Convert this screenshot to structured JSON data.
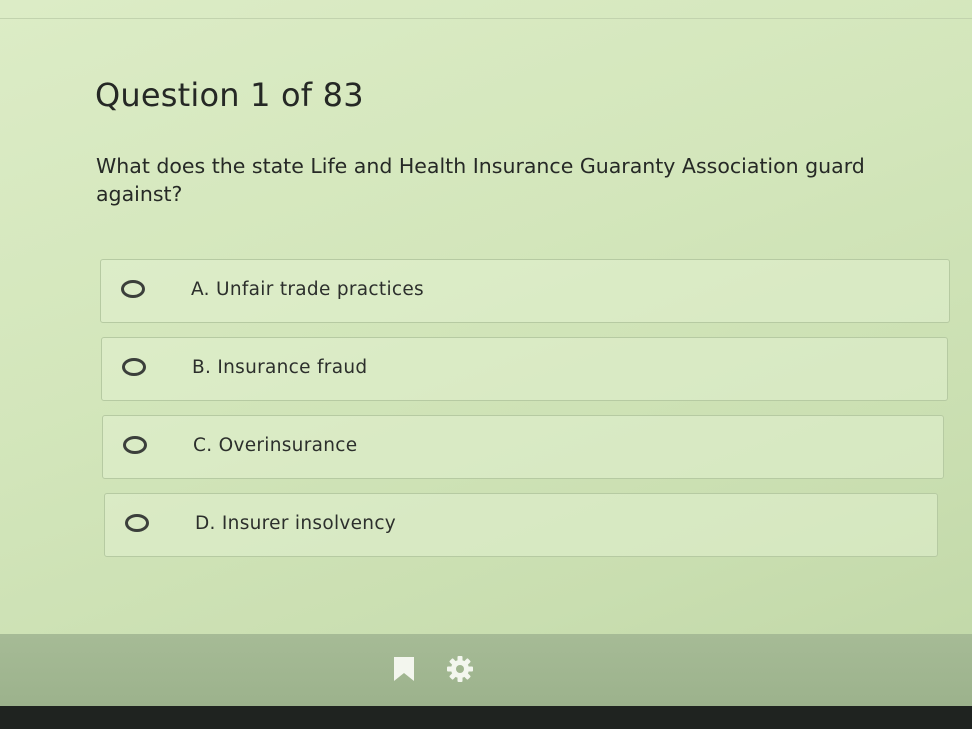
{
  "quiz": {
    "counter": "Question 1 of 83",
    "question": "What does the state Life and Health Insurance Guaranty Association guard against?",
    "options": [
      {
        "label": "A. Unfair trade practices",
        "selected": false
      },
      {
        "label": "B. Insurance fraud",
        "selected": false
      },
      {
        "label": "C. Overinsurance",
        "selected": false
      },
      {
        "label": "D. Insurer insolvency",
        "selected": false
      }
    ]
  },
  "toolbar": {
    "icons": [
      "bookmark-icon",
      "gear-icon"
    ]
  },
  "colors": {
    "background": "#d3e6bb",
    "option_border": "#b6caa2",
    "toolbar": "#a6bb96",
    "icon": "#f3f6ee"
  }
}
